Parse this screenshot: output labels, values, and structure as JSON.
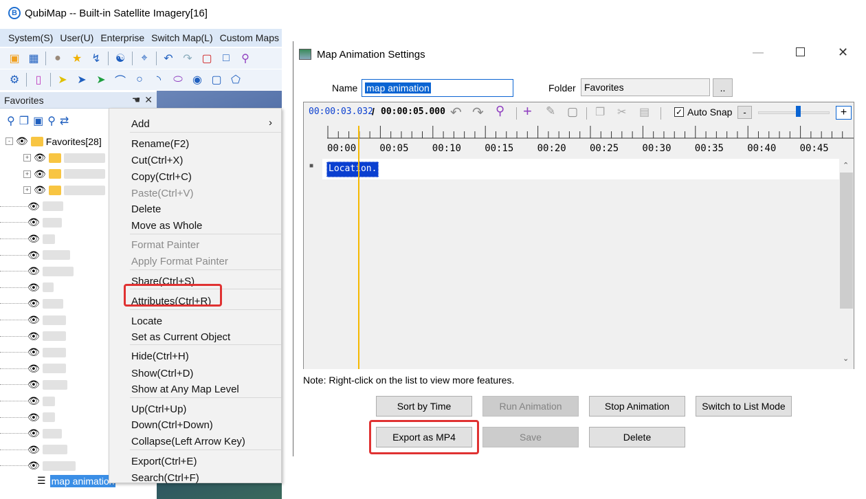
{
  "app": {
    "title": "QubiMap -- Built-in Satellite Imagery[16]",
    "logo_letter": "B",
    "menu": [
      "System(S)",
      "User(U)",
      "Enterprise",
      "Switch Map(L)",
      "Custom Maps"
    ]
  },
  "favorites": {
    "panel_title": "Favorites",
    "root_label": "Favorites[28]",
    "selected_item": "map animation"
  },
  "context_menu": {
    "items": [
      {
        "label": "Add",
        "disabled": false,
        "submenu": true
      },
      {
        "label": "Rename(F2)",
        "disabled": false
      },
      {
        "label": "Cut(Ctrl+X)",
        "disabled": false
      },
      {
        "label": "Copy(Ctrl+C)",
        "disabled": false
      },
      {
        "label": "Paste(Ctrl+V)",
        "disabled": true
      },
      {
        "label": "Delete",
        "disabled": false
      },
      {
        "label": "Move as Whole",
        "disabled": false
      },
      {
        "label": "Format Painter",
        "disabled": true
      },
      {
        "label": "Apply Format Painter",
        "disabled": true
      },
      {
        "label": "Share(Ctrl+S)",
        "disabled": false
      },
      {
        "label": "Attributes(Ctrl+R)",
        "disabled": false,
        "highlighted": true
      },
      {
        "label": "Locate",
        "disabled": false
      },
      {
        "label": "Set as Current Object",
        "disabled": false
      },
      {
        "label": "Hide(Ctrl+H)",
        "disabled": false
      },
      {
        "label": "Show(Ctrl+D)",
        "disabled": false
      },
      {
        "label": "Show at Any Map Level",
        "disabled": false
      },
      {
        "label": "Up(Ctrl+Up)",
        "disabled": false
      },
      {
        "label": "Down(Ctrl+Down)",
        "disabled": false
      },
      {
        "label": "Collapse(Left Arrow Key)",
        "disabled": false
      },
      {
        "label": "Export(Ctrl+E)",
        "disabled": false
      },
      {
        "label": "Search(Ctrl+F)",
        "disabled": false
      }
    ]
  },
  "dialog": {
    "title": "Map Animation Settings",
    "name_label": "Name",
    "name_value": "map animation",
    "folder_label": "Folder",
    "folder_value": "Favorites",
    "browse_label": "..",
    "current_time": "00:00:03.032",
    "separator": "/",
    "total_time": "00:00:05.000",
    "auto_snap_label": "Auto Snap",
    "auto_snap_checked": true,
    "zoom_minus": "-",
    "zoom_plus": "+",
    "ruler_ticks": [
      "00:00",
      "00:05",
      "00:10",
      "00:15",
      "00:20",
      "00:25",
      "00:30",
      "00:35",
      "00:40",
      "00:45"
    ],
    "track_item": "Location.",
    "note": "Note: Right-click on the list to view more features.",
    "buttons": {
      "sort": "Sort by Time",
      "run": "Run Animation",
      "stop": "Stop Animation",
      "switch": "Switch to List Mode",
      "export": "Export as MP4",
      "save": "Save",
      "delete": "Delete"
    },
    "colors": {
      "accent": "#0a64d2",
      "playhead": "#f5b800",
      "highlight": "#e03232"
    }
  }
}
